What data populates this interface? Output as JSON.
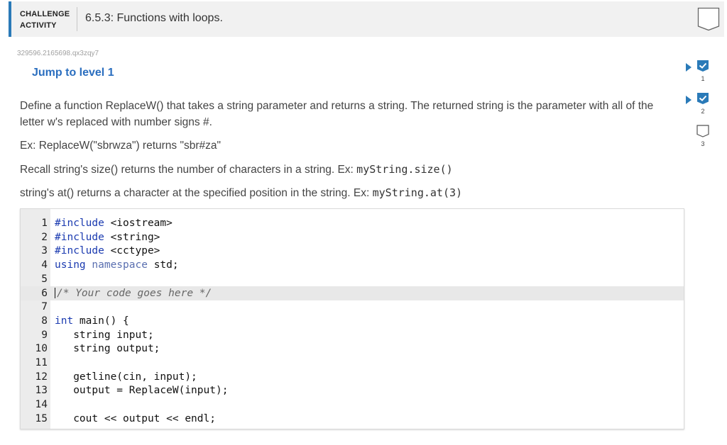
{
  "header": {
    "activity_type": "CHALLENGE ACTIVITY",
    "activity_type_line1": "CHALLENGE",
    "activity_type_line2": "ACTIVITY",
    "title": "6.5.3: Functions with loops."
  },
  "activity_code": "329596.2165698.qx3zqy7",
  "jump_link": "Jump to level 1",
  "instructions": {
    "p1": "Define a function ReplaceW() that takes a string parameter and returns a string. The returned string is the parameter with all of the letter w's replaced with number signs #.",
    "p2": "Ex: ReplaceW(\"sbrwza\") returns \"sbr#za\"",
    "p3_text": "Recall string's size() returns the number of characters in a string. Ex: ",
    "p3_code": "myString.size()",
    "p4_text": "string's at() returns a character at the specified position in the string. Ex: ",
    "p4_code": "myString.at(3)"
  },
  "code": {
    "active_line": 6,
    "lines": [
      {
        "n": "1",
        "text": "#include <iostream>"
      },
      {
        "n": "2",
        "text": "#include <string>"
      },
      {
        "n": "3",
        "text": "#include <cctype>"
      },
      {
        "n": "4",
        "text": "using namespace std;"
      },
      {
        "n": "5",
        "text": ""
      },
      {
        "n": "6",
        "text": "/* Your code goes here */"
      },
      {
        "n": "7",
        "text": ""
      },
      {
        "n": "8",
        "text": "int main() {"
      },
      {
        "n": "9",
        "text": "   string input;"
      },
      {
        "n": "10",
        "text": "   string output;"
      },
      {
        "n": "11",
        "text": ""
      },
      {
        "n": "12",
        "text": "   getline(cin, input);"
      },
      {
        "n": "13",
        "text": "   output = ReplaceW(input);"
      },
      {
        "n": "14",
        "text": ""
      },
      {
        "n": "15",
        "text": "   cout << output << endl;"
      }
    ]
  },
  "levels": [
    {
      "label": "1",
      "completed": true
    },
    {
      "label": "2",
      "completed": true
    },
    {
      "label": "3",
      "completed": false
    }
  ],
  "colors": {
    "accent": "#2a7ab8",
    "link": "#2a6ebf",
    "check_fill": "#2a7ab8"
  }
}
